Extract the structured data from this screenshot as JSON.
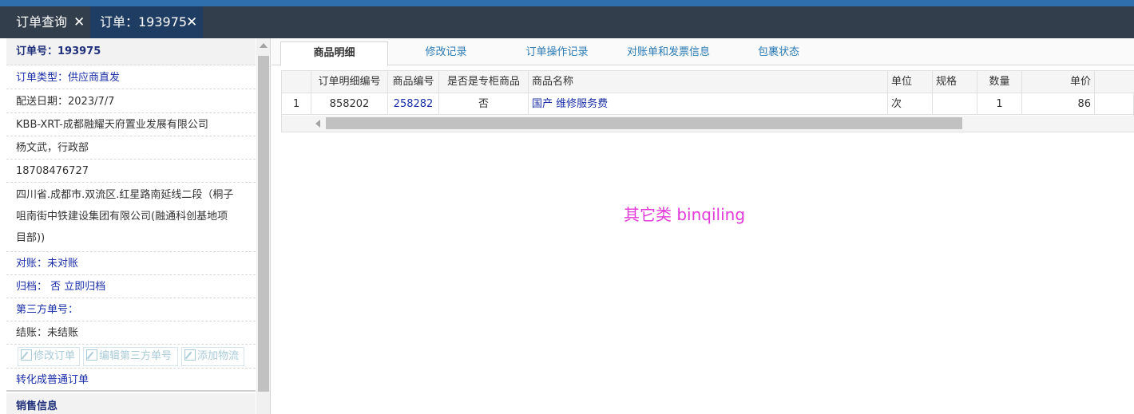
{
  "tabs": [
    {
      "label": "订单查询"
    },
    {
      "label": "订单：193975"
    }
  ],
  "close_glyph": "✕",
  "order": {
    "number": "订单号：193975",
    "type": "订单类型：供应商直发",
    "delivery_date": "配送日期：2023/7/7",
    "company": "KBB-XRT-成都融耀天府置业发展有限公司",
    "contact": "杨文武，行政部",
    "phone": "18708476727",
    "address_line1": "四川省.成都市.双流区.红星路南延线二段（桐子",
    "address_line2": "咀南街中铁建设集团有限公司(融通科创基地项",
    "address_line3": "目部))",
    "reconcile": "对账：未对账",
    "archive": "归档： 否 立即归档",
    "third_party_no": "第三方单号：",
    "settlement": "结账：未结账",
    "buttons": {
      "edit_order": "修改订单",
      "edit_third_party": "编辑第三方单号",
      "add_logistics": "添加物流"
    },
    "convert": "转化成普通订单",
    "sales_section": "销售信息"
  },
  "subtabs": [
    {
      "label": "商品明细",
      "active": true
    },
    {
      "label": "修改记录"
    },
    {
      "label": "订单操作记录"
    },
    {
      "label": "对账单和发票信息"
    },
    {
      "label": "包裹状态"
    }
  ],
  "table": {
    "headers": [
      "",
      "订单明细编号",
      "商品编号",
      "是否是专柜商品",
      "商品名称",
      "单位",
      "规格",
      "数量",
      "单价"
    ],
    "rows": [
      [
        "1",
        "858202",
        "258282",
        "否",
        "国产 维修服务费",
        "次",
        "",
        "1",
        "86"
      ]
    ]
  },
  "note": "其它类 binqiling",
  "colors": {
    "tabbar": "#323e4b",
    "active_tab": "#1f3d63",
    "link_blue": "#1a2fa8",
    "note_magenta": "#e23ad8"
  }
}
